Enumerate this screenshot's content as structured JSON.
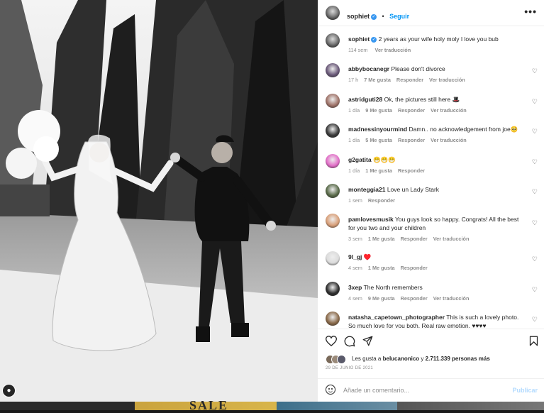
{
  "post": {
    "username": "sophiet",
    "follow_label": "Seguir",
    "more_label": "•••",
    "caption_text": "2 years as your wife holy moly I love you bub",
    "caption_age": "114 sem",
    "caption_translate": "Ver traducción"
  },
  "comments": [
    {
      "user": "abbybocanegr",
      "text": "Please don't divorce",
      "age": "17 h",
      "likes": "7 Me gusta",
      "reply": "Responder",
      "translate": "Ver traducción",
      "avatar_color": "#6b5a7a"
    },
    {
      "user": "astridguti28",
      "text": "Ok, the pictures still here 🎩",
      "age": "1 día",
      "likes": "9 Me gusta",
      "reply": "Responder",
      "translate": "Ver traducción",
      "avatar_color": "#a0746a"
    },
    {
      "user": "madnessinyourmind",
      "text": "Damn.. no acknowledgement from joe🥺",
      "age": "1 día",
      "likes": "5 Me gusta",
      "reply": "Responder",
      "translate": "Ver traducción",
      "avatar_color": "#3a3a3a"
    },
    {
      "user": "g2gatita",
      "text": "😁😁😁",
      "age": "1 día",
      "likes": "1 Me gusta",
      "reply": "Responder",
      "translate": "",
      "avatar_color": "#e26fc8"
    },
    {
      "user": "monteggia21",
      "text": "Love un Lady Stark",
      "age": "1 sem",
      "likes": "",
      "reply": "Responder",
      "translate": "",
      "avatar_color": "#5a6b4a"
    },
    {
      "user": "pamlovesmusik",
      "text": "You guys look so happy. Congrats! All the best for you two and your children",
      "age": "3 sem",
      "likes": "1 Me gusta",
      "reply": "Responder",
      "translate": "Ver traducción",
      "avatar_color": "#d9a07a"
    },
    {
      "user": "9l_gj",
      "text": "♥️",
      "age": "4 sem",
      "likes": "1 Me gusta",
      "reply": "Responder",
      "translate": "",
      "avatar_color": "#dcdcdc"
    },
    {
      "user": "3xep",
      "text": "The North remembers",
      "age": "4 sem",
      "likes": "9 Me gusta",
      "reply": "Responder",
      "translate": "Ver traducción",
      "avatar_color": "#2e2e2e"
    },
    {
      "user": "natasha_capetown_photographer",
      "text": "This is such a lovely photo. So much love for you both. Real raw emotion. ♥♥♥♥",
      "age": "",
      "likes": "",
      "reply": "",
      "translate": "",
      "avatar_color": "#8a6a4a"
    }
  ],
  "likes": {
    "prefix": "Les gusta a",
    "user": "belucanonico",
    "joiner": "y",
    "count": "2.711.339 personas más",
    "date": "29 DE JUNIO DE 2021"
  },
  "add_comment": {
    "placeholder": "Añade un comentario...",
    "publish": "Publicar"
  },
  "icons": {
    "heart": "heart-icon",
    "comment": "comment-icon",
    "share": "share-icon",
    "save": "bookmark-icon"
  },
  "banner": {
    "text": "SALE"
  }
}
